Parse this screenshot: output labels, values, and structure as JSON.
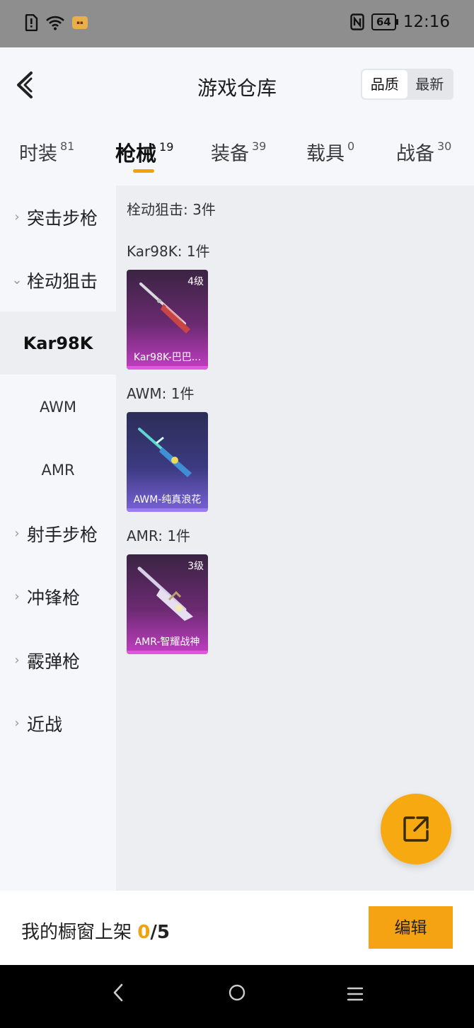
{
  "status_bar": {
    "time": "12:16",
    "battery": "64"
  },
  "header": {
    "title": "游戏仓库",
    "sort": {
      "quality": "品质",
      "newest": "最新"
    }
  },
  "tabs": [
    {
      "label": "时装",
      "count": "81"
    },
    {
      "label": "枪械",
      "count": "19"
    },
    {
      "label": "装备",
      "count": "39"
    },
    {
      "label": "载具",
      "count": "0"
    },
    {
      "label": "战备",
      "count": "30"
    }
  ],
  "sidebar": {
    "categories": [
      {
        "label": "突击步枪"
      },
      {
        "label": "栓动狙击"
      },
      {
        "label": "射手步枪"
      },
      {
        "label": "冲锋枪"
      },
      {
        "label": "霰弹枪"
      },
      {
        "label": "近战"
      }
    ],
    "subitems": [
      {
        "label": "Kar98K"
      },
      {
        "label": "AWM"
      },
      {
        "label": "AMR"
      }
    ]
  },
  "content": {
    "summary": "栓动狙击: 3件",
    "groups": [
      {
        "label": "Kar98K: 1件",
        "item": {
          "name": "Kar98K-巴巴...",
          "level": "4级"
        }
      },
      {
        "label": "AWM: 1件",
        "item": {
          "name": "AWM-纯真浪花",
          "level": ""
        }
      },
      {
        "label": "AMR: 1件",
        "item": {
          "name": "AMR-智耀战神",
          "level": "3级"
        }
      }
    ]
  },
  "bottom_bar": {
    "shelf_label": "我的橱窗上架",
    "shelf_count": "0",
    "shelf_total": "/5",
    "edit_label": "编辑"
  },
  "colors": {
    "accent": "#f5a312",
    "rarity_pink": "#c13ec2",
    "rarity_blue": "#7a62d8"
  }
}
